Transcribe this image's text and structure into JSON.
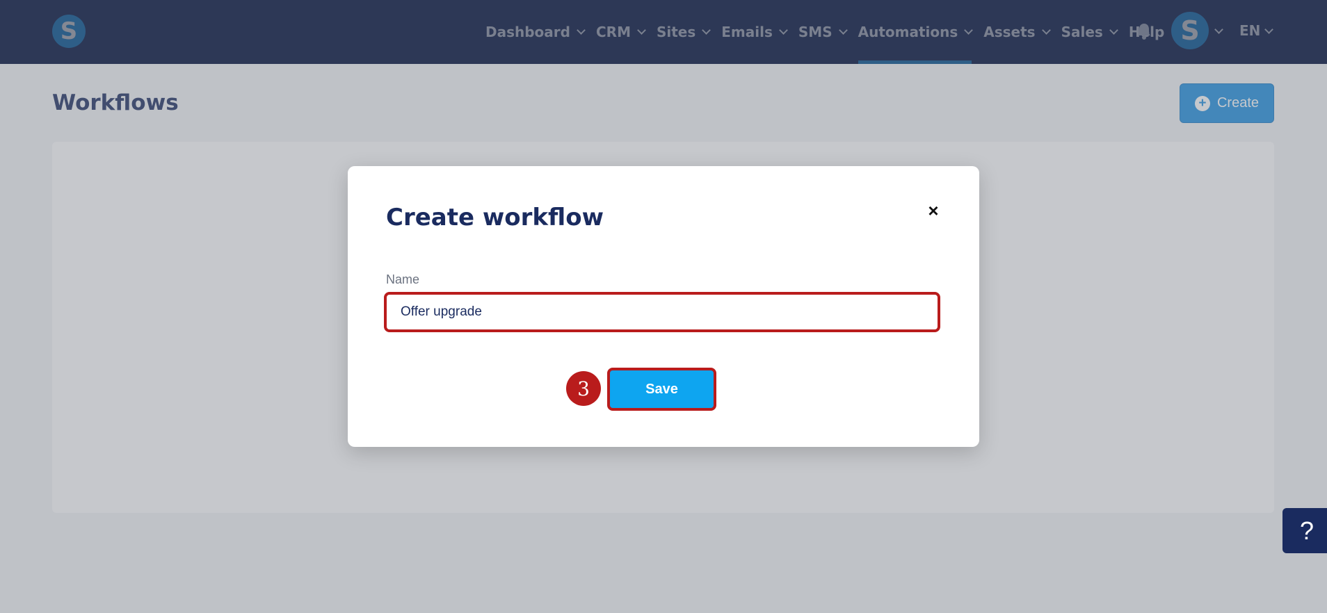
{
  "app": {
    "logo_letter": "S",
    "avatar_letter": "S",
    "language": "EN"
  },
  "nav": {
    "items": [
      {
        "label": "Dashboard",
        "has_dropdown": true
      },
      {
        "label": "CRM",
        "has_dropdown": true
      },
      {
        "label": "Sites",
        "has_dropdown": true
      },
      {
        "label": "Emails",
        "has_dropdown": true
      },
      {
        "label": "SMS",
        "has_dropdown": true
      },
      {
        "label": "Automations",
        "has_dropdown": true,
        "active": true
      },
      {
        "label": "Assets",
        "has_dropdown": true
      },
      {
        "label": "Sales",
        "has_dropdown": true
      },
      {
        "label": "Help",
        "has_dropdown": false
      }
    ],
    "icons": {
      "notifications": "bell-icon"
    }
  },
  "page": {
    "title": "Workflows",
    "create_label": "Create"
  },
  "modal": {
    "title": "Create workflow",
    "close_symbol": "×",
    "name_label": "Name",
    "name_value": "Offer upgrade",
    "save_label": "Save",
    "step_number": "3"
  },
  "help_widget": {
    "symbol": "?"
  },
  "colors": {
    "nav_bg": "#1a2b5f",
    "accent": "#1e8fe0",
    "save_button": "#0ea5f0",
    "highlight": "#b91c1c"
  }
}
